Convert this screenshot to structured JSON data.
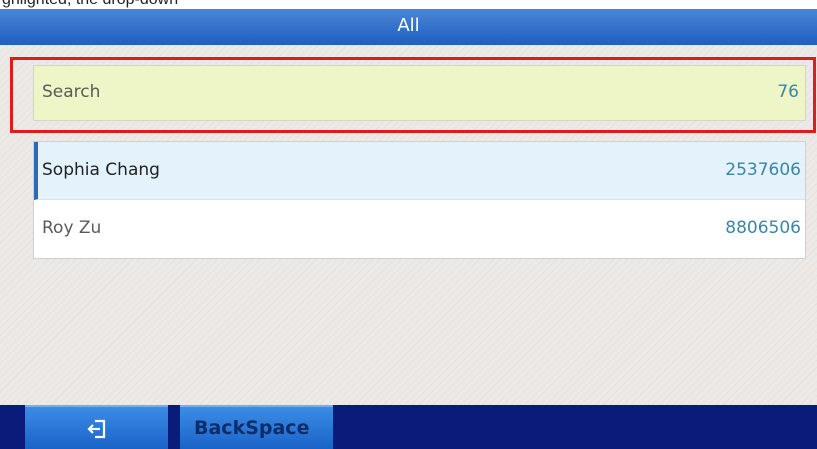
{
  "top_strip": {
    "text": "ghlighted, the drop-down"
  },
  "header": {
    "title": "All"
  },
  "search": {
    "label": "Search",
    "value": "76"
  },
  "contacts": [
    {
      "name": "Sophia Chang",
      "number": "2537606",
      "selected": true
    },
    {
      "name": "Roy Zu",
      "number": "8806506",
      "selected": false
    }
  ],
  "softkeys": {
    "back_icon": "exit-icon",
    "backspace_label": "BackSpace"
  },
  "colors": {
    "title_bar": "#1f5fbf",
    "search_row": "#eef5c6",
    "selected_row": "#e3f2fb",
    "number_text": "#3a86a8",
    "highlight": "#e11b1b",
    "bottom_bar": "#0b1b7a"
  }
}
